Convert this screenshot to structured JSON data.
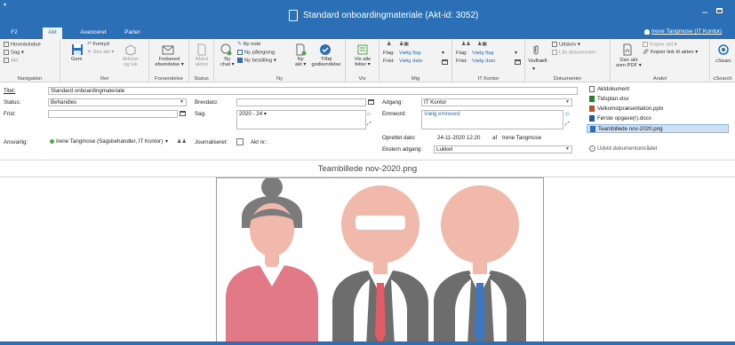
{
  "window": {
    "title": "Standard onboardingmateriale (Akt-id: 3052)",
    "minimize": "–",
    "menu_caret": "▾"
  },
  "tabs": [
    "F2",
    "Akt",
    "Avanceret",
    "Parter"
  ],
  "user": "Irene Tangmose (IT Kontor)",
  "ribbon": {
    "navigation": {
      "label": "Navigation",
      "items": [
        "Hovedvindue",
        "Sag ▾",
        "Akt"
      ]
    },
    "ret": {
      "label": "Ret",
      "gem": "Gem",
      "fortryd": "Fortryd",
      "slet": "Slet akt ▾",
      "arkiver": [
        "Arkiver",
        "og luk"
      ]
    },
    "forsendelse": {
      "label": "Forsendelse",
      "btn": [
        "Forbered",
        "afsendelse ▾"
      ]
    },
    "status": {
      "label": "Status",
      "btn": [
        "Afslut",
        "akten"
      ]
    },
    "ny": {
      "label": "Ny",
      "chat": [
        "Ny",
        "chat ▾"
      ],
      "note": "Ny note",
      "paategning": "Ny påtegning",
      "bestilling": "Ny bestilling ▾",
      "akt": [
        "Ny",
        "akt ▾"
      ],
      "godkendelse": [
        "Tilføj",
        "godkendelse"
      ]
    },
    "vis": {
      "label": "Vis",
      "btn": [
        "Vis alle",
        "felter ▾"
      ]
    },
    "mig": {
      "label": "Mig",
      "flag": "Flag:",
      "flag_val": "Vælg flag",
      "frist": "Frist:",
      "frist_val": "Vælg dato"
    },
    "itkontor": {
      "label": "IT Kontor",
      "flag": "Flag:",
      "flag_val": "Vælg flag",
      "frist": "Frist:",
      "frist_val": "Vælg dato"
    },
    "dokumenter": {
      "label": "Dokumenter",
      "vedhaeft": "Vedhæft",
      "udskriv": "Udskriv ▾",
      "laas": "Lås dokumenter"
    },
    "andet": {
      "label": "Andet",
      "kopier_akt": "Kopier akt ▾",
      "kopier_link": "Kopier link til akten ▾",
      "pdf": [
        "Dan akt",
        "som PDF ▾"
      ]
    },
    "search": {
      "label": "cSearch",
      "btn": "cSearc"
    }
  },
  "form": {
    "titel_label": "Titel:",
    "titel_value": "Standard onboardingmateriale",
    "status_label": "Status:",
    "status_value": "Behandles",
    "frist_label": "Frist:",
    "frist_value": "",
    "ansvarlig_label": "Ansvarlig:",
    "ansvarlig_value": "Irene Tangmose (Sagsbehandler, IT Kontor)",
    "brevdato_label": "Brevdato:",
    "sag_label": "Sag:",
    "sag_value": "2020 - 24 ▾",
    "journaliseret_label": "Journaliseret:",
    "aktnr_label": "Akt nr.:",
    "adgang_label": "Adgang:",
    "adgang_value": "IT Kontor",
    "emneord_label": "Emneord:",
    "emneord_placeholder": "Vælg emneord",
    "oprettet_label": "Oprettet dato:",
    "oprettet_value": "24-11-2020 12:20",
    "oprettet_af": "af",
    "oprettet_by": "Irene Tangmose",
    "ekstern_label": "Ekstern adgang:",
    "ekstern_value": "Lukket"
  },
  "documents": {
    "items": [
      {
        "name": "Aktdokument",
        "kind": "doc"
      },
      {
        "name": "Tidsplan.xlsx",
        "kind": "xl"
      },
      {
        "name": "Velkomstpræsentation.pptx",
        "kind": "pp"
      },
      {
        "name": "Første opgave(r).docx",
        "kind": "wd"
      },
      {
        "name": "Teambillede nov-2020.png",
        "kind": "img"
      }
    ],
    "expand": "Udvid dokumentområdet"
  },
  "preview": {
    "title": "Teambillede nov-2020.png"
  },
  "colors": {
    "accent": "#2b6fb6",
    "skin": "#f1b9ab",
    "hair": "#7b7b7b",
    "pink": "#e17a86",
    "suit": "#6d6d6d",
    "tie_red": "#e25b66",
    "tie_blue": "#3d78bf"
  }
}
